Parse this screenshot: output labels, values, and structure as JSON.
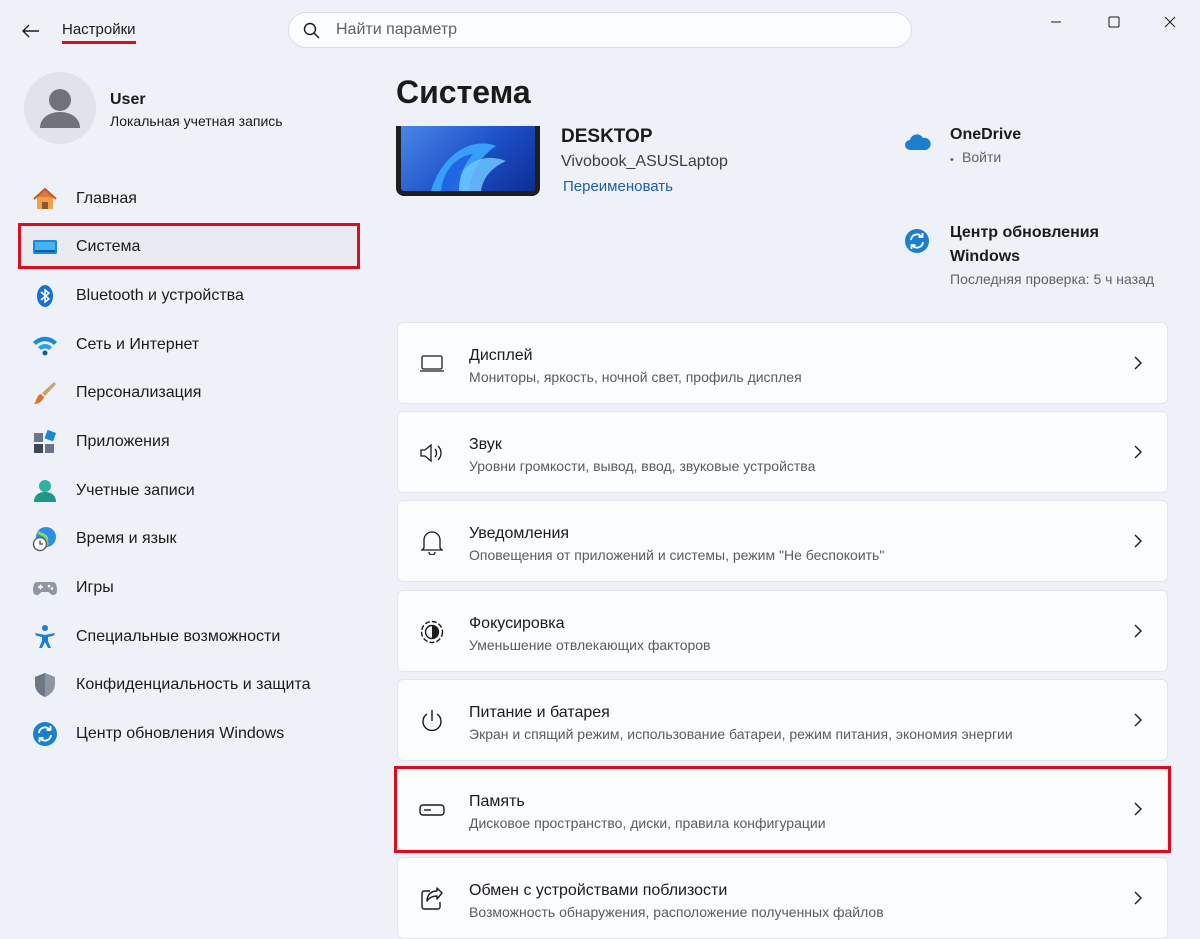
{
  "window": {
    "title": "Настройки"
  },
  "search": {
    "placeholder": "Найти параметр"
  },
  "profile": {
    "name": "User",
    "account_type": "Локальная учетная запись"
  },
  "sidebar": {
    "items": [
      {
        "label": "Главная",
        "icon": "home-icon"
      },
      {
        "label": "Система",
        "icon": "system-icon",
        "selected": true
      },
      {
        "label": "Bluetooth и устройства",
        "icon": "bluetooth-icon"
      },
      {
        "label": "Сеть и Интернет",
        "icon": "wifi-icon"
      },
      {
        "label": "Персонализация",
        "icon": "brush-icon"
      },
      {
        "label": "Приложения",
        "icon": "apps-icon"
      },
      {
        "label": "Учетные записи",
        "icon": "accounts-icon"
      },
      {
        "label": "Время и язык",
        "icon": "time-language-icon"
      },
      {
        "label": "Игры",
        "icon": "gamepad-icon"
      },
      {
        "label": "Специальные возможности",
        "icon": "accessibility-icon"
      },
      {
        "label": "Конфиденциальность и защита",
        "icon": "shield-icon"
      },
      {
        "label": "Центр обновления Windows",
        "icon": "windows-update-icon"
      }
    ]
  },
  "main": {
    "title": "Система",
    "device": {
      "name": "DESKTOP",
      "model": "Vivobook_ASUSLaptop",
      "rename_label": "Переименовать"
    },
    "onedrive": {
      "name": "OneDrive",
      "dot": "•",
      "status": "Войти"
    },
    "update": {
      "title": "Центр обновления Windows",
      "last_check": "Последняя проверка: 5 ч назад"
    },
    "cards": [
      {
        "title": "Дисплей",
        "subtitle": "Мониторы, яркость, ночной свет, профиль дисплея",
        "icon": "display-icon"
      },
      {
        "title": "Звук",
        "subtitle": "Уровни громкости, вывод, ввод, звуковые устройства",
        "icon": "speaker-icon"
      },
      {
        "title": "Уведомления",
        "subtitle": "Оповещения от приложений и системы, режим \"Не беспокоить\"",
        "icon": "bell-icon"
      },
      {
        "title": "Фокусировка",
        "subtitle": "Уменьшение отвлекающих факторов",
        "icon": "focus-icon"
      },
      {
        "title": "Питание и батарея",
        "subtitle": "Экран и спящий режим, использование батареи, режим питания, экономия энергии",
        "icon": "power-icon"
      },
      {
        "title": "Память",
        "subtitle": "Дисковое пространство, диски, правила конфигурации",
        "icon": "storage-icon"
      },
      {
        "title": "Обмен с устройствами поблизости",
        "subtitle": "Возможность обнаружения, расположение полученных файлов",
        "icon": "share-icon"
      }
    ]
  },
  "colors": {
    "accent": "#0067c0",
    "highlight": "#d6101f",
    "background": "#eef1f8"
  }
}
